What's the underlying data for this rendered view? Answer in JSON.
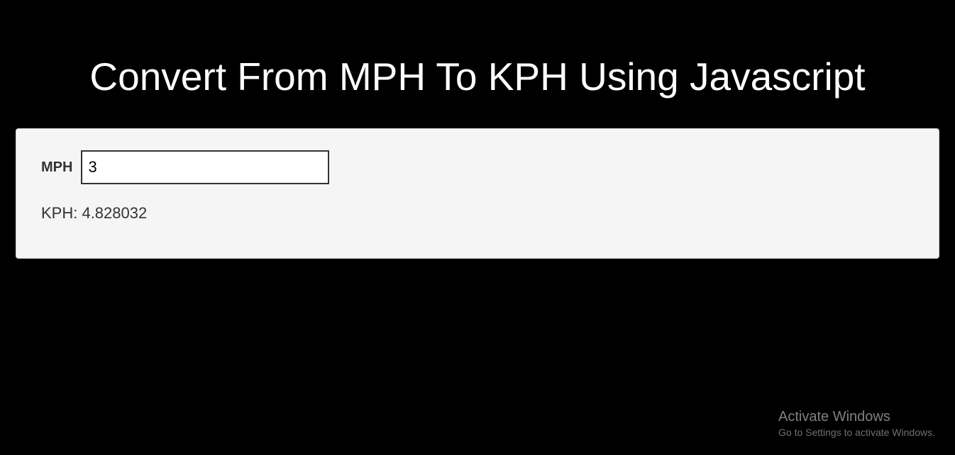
{
  "header": {
    "title": "Convert From MPH To KPH Using Javascript"
  },
  "form": {
    "mph_label": "MPH",
    "mph_value": "3"
  },
  "result": {
    "text": "KPH: 4.828032"
  },
  "watermark": {
    "line1": "Activate Windows",
    "line2": "Go to Settings to activate Windows."
  }
}
